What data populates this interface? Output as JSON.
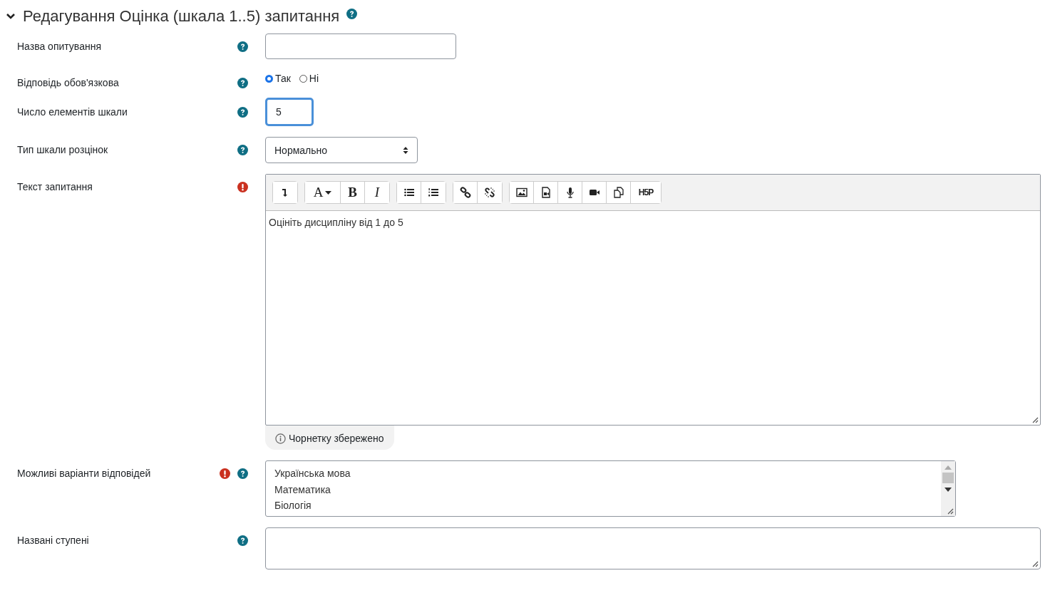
{
  "section": {
    "title": "Редагування Оцінка (шкала 1..5) запитання",
    "expanded": true
  },
  "fields": [
    {
      "kind": "text",
      "label": "Назва опитування",
      "required": false,
      "help": true
    },
    {
      "kind": "radio",
      "label": "Відповідь обов'язкова",
      "required": false,
      "help": true,
      "options": [
        {
          "label": "Так",
          "selected": true
        },
        {
          "label": "Ні",
          "selected": false
        }
      ]
    },
    {
      "kind": "number",
      "label": "Число елементів шкали",
      "required": false,
      "help": true,
      "value": "5",
      "focused": true
    },
    {
      "kind": "select",
      "label": "Тип шкали розцінок",
      "required": false,
      "help": true,
      "value": "Нормально"
    },
    {
      "kind": "editor",
      "label": "Текст запитання",
      "required": true,
      "help": false,
      "value": "Оцініть дисципліну від 1 до 5",
      "toolbar": [
        [
          {
            "kind": "expand"
          }
        ],
        [
          {
            "kind": "font",
            "label": "A"
          },
          {
            "kind": "bold",
            "label": "B"
          },
          {
            "kind": "italic",
            "label": "I"
          }
        ],
        [
          {
            "kind": "bullets"
          },
          {
            "kind": "numbers"
          }
        ],
        [
          {
            "kind": "link"
          },
          {
            "kind": "unlink"
          }
        ],
        [
          {
            "kind": "image"
          },
          {
            "kind": "media"
          },
          {
            "kind": "mic"
          },
          {
            "kind": "video"
          },
          {
            "kind": "copy"
          },
          {
            "kind": "h5p",
            "label": "H5P"
          }
        ]
      ],
      "note": "Чорнетку збережено"
    },
    {
      "kind": "list",
      "label": "Можливі варіанти відповідей",
      "required": true,
      "help": true,
      "lines": [
        "Українська мова",
        "Математика",
        "Біологія"
      ]
    },
    {
      "kind": "textarea",
      "label": "Названі ступені",
      "required": false,
      "help": true
    }
  ]
}
